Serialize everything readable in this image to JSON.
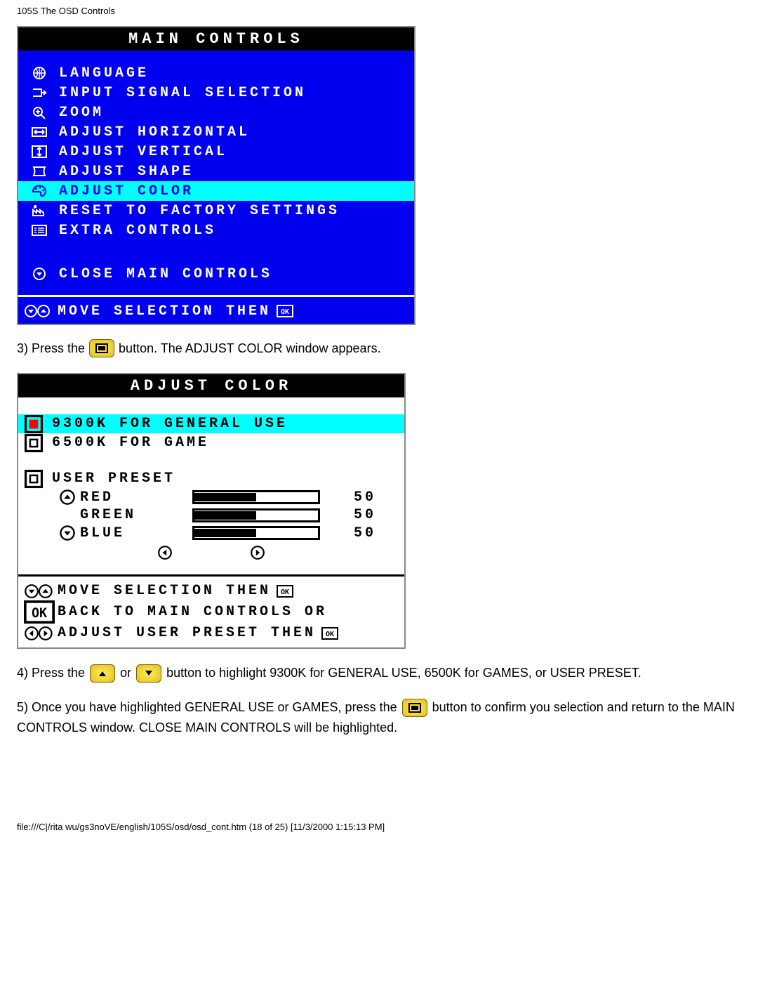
{
  "header": "105S The OSD Controls",
  "main_panel": {
    "title": "MAIN CONTROLS",
    "items": [
      "LANGUAGE",
      "INPUT SIGNAL SELECTION",
      "ZOOM",
      "ADJUST HORIZONTAL",
      "ADJUST VERTICAL",
      "ADJUST SHAPE",
      "ADJUST COLOR",
      "RESET TO FACTORY SETTINGS",
      "EXTRA CONTROLS"
    ],
    "selected_index": 6,
    "close_label": "CLOSE MAIN CONTROLS",
    "footer": "MOVE SELECTION THEN"
  },
  "step3": {
    "prefix": "3) Press the",
    "suffix": "button. The ADJUST COLOR window appears."
  },
  "color_panel": {
    "title": "ADJUST COLOR",
    "options": [
      {
        "label": "9300K FOR GENERAL USE",
        "selected": true
      },
      {
        "label": "6500K FOR GAME",
        "selected": false
      }
    ],
    "user_preset": {
      "label": "USER PRESET",
      "rgb": [
        {
          "name": "RED",
          "value": 50
        },
        {
          "name": "GREEN",
          "value": 50
        },
        {
          "name": "BLUE",
          "value": 50
        }
      ]
    },
    "footer": [
      "MOVE SELECTION THEN",
      "BACK TO MAIN CONTROLS OR",
      "ADJUST USER PRESET THEN"
    ]
  },
  "step4": {
    "prefix": "4) Press the",
    "mid": "or",
    "suffix": "button to highlight 9300K for GENERAL USE, 6500K for GAMES, or USER PRESET."
  },
  "step5": {
    "prefix": "5) Once you have highlighted GENERAL USE or GAMES, press the",
    "suffix": "button to confirm you selection and return to the MAIN CONTROLS window. CLOSE MAIN CONTROLS will be highlighted."
  },
  "footer_path": "file:///C|/rita wu/gs3noVE/english/105S/osd/osd_cont.htm (18 of 25) [11/3/2000 1:15:13 PM]"
}
